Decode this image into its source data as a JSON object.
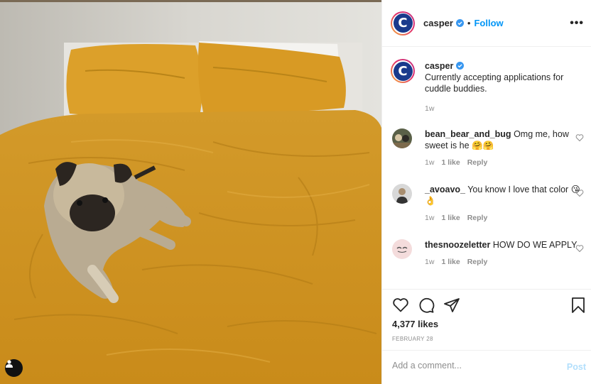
{
  "post": {
    "username": "casper",
    "follow_label": "Follow",
    "dot": "•",
    "more": "•••",
    "caption": {
      "username": "casper",
      "text": "Currently accepting applications for cuddle buddies.",
      "time": "1w"
    },
    "avatar_letter": "C"
  },
  "comments": [
    {
      "username": "bean_bear_and_bug",
      "text": "Omg me, how sweet is he 🤗🤗",
      "time": "1w",
      "likes": "1 like",
      "reply": "Reply"
    },
    {
      "username": "_avoavo_",
      "text": "You know I love that color 😘👌",
      "time": "1w",
      "likes": "1 like",
      "reply": "Reply"
    },
    {
      "username": "thesnoozeletter",
      "text": "HOW DO WE APPLY",
      "time": "1w",
      "likes": "1 like",
      "reply": "Reply"
    }
  ],
  "actions": {
    "likes": "4,377 likes",
    "date": "FEBRUARY 28"
  },
  "add_comment": {
    "placeholder": "Add a comment...",
    "post_label": "Post"
  },
  "colors": {
    "accent": "#0095f6",
    "bedsheet": "#d99b22",
    "brand_blue": "#1a3a8c"
  }
}
